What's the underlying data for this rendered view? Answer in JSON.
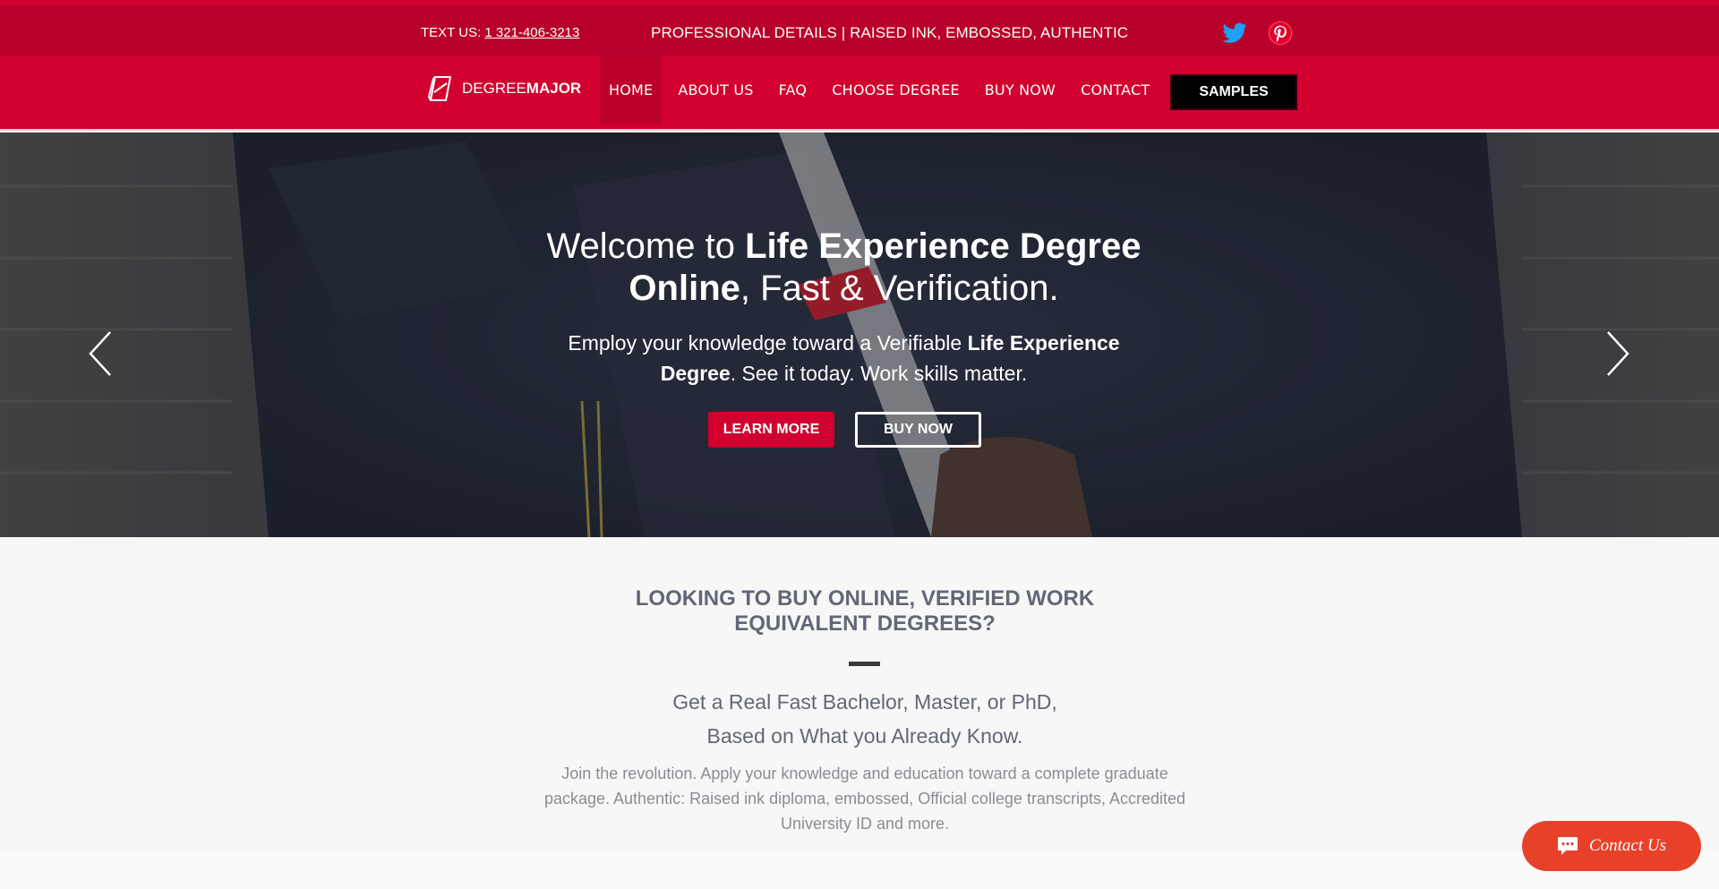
{
  "topbar": {
    "text_us_label": "TEXT US:",
    "phone": "1 321-406-3213",
    "tagline": "PROFESSIONAL DETAILS | RAISED INK, EMBOSSED, AUTHENTIC",
    "social": [
      "twitter-icon",
      "pinterest-icon"
    ]
  },
  "logo": {
    "part1": "DEGREE",
    "part2": "MAJOR"
  },
  "nav": {
    "items": [
      "HOME",
      "ABOUT US",
      "FAQ",
      "CHOOSE DEGREE",
      "BUY NOW",
      "CONTACT"
    ],
    "active": "HOME",
    "samples": "SAMPLES"
  },
  "hero": {
    "title_a": "Welcome to ",
    "title_b": "Life Experience Degree Online",
    "title_c": ", Fast & Verification.",
    "sub_a": "Employ your knowledge toward a Verifiable ",
    "sub_b": "Life Experience Degree",
    "sub_c": ". See it today. Work skills matter.",
    "btn_learn": "LEARN MORE",
    "btn_buy": "BUY NOW"
  },
  "content": {
    "heading": "LOOKING TO BUY ONLINE, VERIFIED WORK EQUIVALENT DEGREES?",
    "sub_line1": "Get a Real Fast Bachelor, Master, or PhD,",
    "sub_line2": "Based on What you Already Know.",
    "body": "Join the revolution. Apply your knowledge and education toward a complete graduate package. Authentic:  Raised ink diploma, embossed, Official college transcripts, Accredited University ID and more."
  },
  "contact_widget": {
    "label": "Contact Us"
  },
  "colors": {
    "brand_red": "#d2002f",
    "topbar_red": "#b8002a",
    "widget_orange": "#e8412a"
  }
}
